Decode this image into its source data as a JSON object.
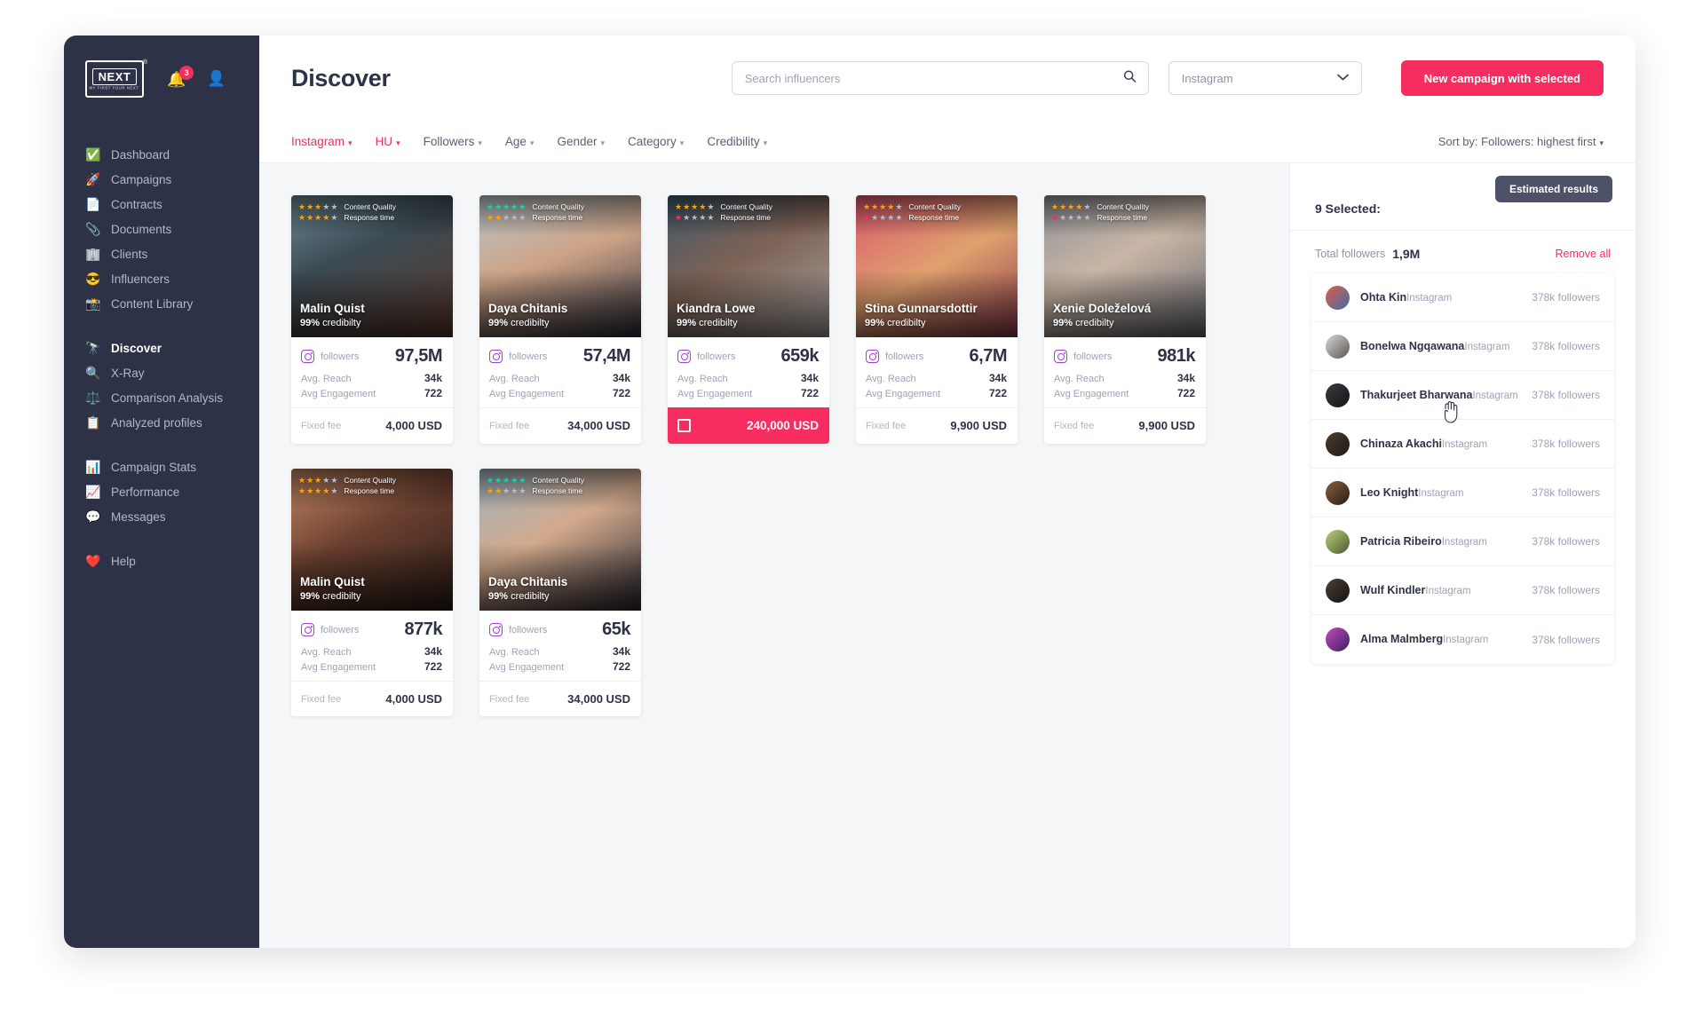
{
  "sidebar": {
    "logo": {
      "text": "NEXT",
      "tagline": "MY FIRST YOUR NEXT",
      "registered": "®"
    },
    "notifications": {
      "icon": "bell-icon",
      "count": "3"
    },
    "account_icon": "user-icon",
    "groups": [
      {
        "items": [
          {
            "icon": "✅",
            "icon_name": "check-mark-icon",
            "label": "Dashboard",
            "active": false
          },
          {
            "icon": "🚀",
            "icon_name": "rocket-icon",
            "label": "Campaigns",
            "active": false
          },
          {
            "icon": "📄",
            "icon_name": "document-icon",
            "label": "Contracts",
            "active": false
          },
          {
            "icon": "📎",
            "icon_name": "paperclip-icon",
            "label": "Documents",
            "active": false
          },
          {
            "icon": "🏢",
            "icon_name": "building-icon",
            "label": "Clients",
            "active": false
          },
          {
            "icon": "😎",
            "icon_name": "sunglasses-face-icon",
            "label": "Influencers",
            "active": false
          },
          {
            "icon": "📸",
            "icon_name": "camera-icon",
            "label": "Content Library",
            "active": false
          }
        ]
      },
      {
        "items": [
          {
            "icon": "🔭",
            "icon_name": "telescope-icon",
            "label": "Discover",
            "active": true
          },
          {
            "icon": "🔍",
            "icon_name": "magnifier-icon",
            "label": "X-Ray",
            "active": false
          },
          {
            "icon": "⚖️",
            "icon_name": "scales-icon",
            "label": "Comparison Analysis",
            "active": false
          },
          {
            "icon": "📋",
            "icon_name": "clipboard-icon",
            "label": "Analyzed profiles",
            "active": false
          }
        ]
      },
      {
        "items": [
          {
            "icon": "📊",
            "icon_name": "bar-chart-icon",
            "label": "Campaign Stats",
            "active": false
          },
          {
            "icon": "📈",
            "icon_name": "line-chart-icon",
            "label": "Performance",
            "active": false
          },
          {
            "icon": "💬",
            "icon_name": "speech-bubble-icon",
            "label": "Messages",
            "active": false
          }
        ]
      },
      {
        "items": [
          {
            "icon": "❤️",
            "icon_name": "heart-icon",
            "label": "Help",
            "active": false
          }
        ]
      }
    ]
  },
  "header": {
    "title": "Discover",
    "search": {
      "placeholder": "Search influencers",
      "value": "",
      "icon": "search-icon"
    },
    "platform_select": {
      "value": "Instagram",
      "icon": "chevron-down-icon"
    },
    "cta": "New campaign with selected"
  },
  "filters": {
    "items": [
      {
        "label": "Instagram",
        "highlight": true
      },
      {
        "label": "HU",
        "highlight": true
      },
      {
        "label": "Followers",
        "highlight": false
      },
      {
        "label": "Age",
        "highlight": false
      },
      {
        "label": "Gender",
        "highlight": false
      },
      {
        "label": "Category",
        "highlight": false
      },
      {
        "label": "Credibility",
        "highlight": false
      }
    ],
    "sort": "Sort by: Followers: highest first"
  },
  "labels": {
    "content_quality": "Content Quality",
    "response_time": "Response time",
    "followers": "followers",
    "avg_reach": "Avg. Reach",
    "avg_engagement": "Avg Engagement",
    "fixed_fee": "Fixed fee",
    "credibility_suffix": "credibilty"
  },
  "cards": [
    {
      "name": "Malin Quist",
      "credibility": "99%",
      "credibility_label": "credibilty",
      "followers": "97,5M",
      "avg_reach": "34k",
      "avg_engagement": "722",
      "fee": "4,000 USD",
      "selected": false,
      "quality_stars": 3,
      "quality_color": "#f5a21c",
      "response_stars": 4,
      "response_color": "#f5a21c",
      "photo": "linear-gradient(155deg,#6d8a94 0%,#3b4a52 40%,#5c3a2e 100%)"
    },
    {
      "name": "Daya Chitanis",
      "credibility": "99%",
      "credibility_label": "credibilty",
      "followers": "57,4M",
      "avg_reach": "34k",
      "avg_engagement": "722",
      "fee": "34,000 USD",
      "selected": false,
      "quality_stars": 5,
      "quality_color": "#1ccfae",
      "response_stars": 2,
      "response_color": "#f5a21c",
      "photo": "linear-gradient(160deg,#b9c7cc 0%,#cda387 45%,#2c2f3c 100%)"
    },
    {
      "name": "Kiandra Lowe",
      "credibility": "99%",
      "credibility_label": "credibilty",
      "followers": "659k",
      "avg_reach": "34k",
      "avg_engagement": "722",
      "fee": "240,000 USD",
      "selected": true,
      "quality_stars": 4,
      "quality_color": "#f5a21c",
      "response_stars": 1,
      "response_color": "#f72d5f",
      "photo": "linear-gradient(150deg,#41596b 0%,#7d6255 45%,#a9a5a2 100%)"
    },
    {
      "name": "Stina Gunnarsdottir",
      "credibility": "99%",
      "credibility_label": "credibilty",
      "followers": "6,7M",
      "avg_reach": "34k",
      "avg_engagement": "722",
      "fee": "9,900 USD",
      "selected": false,
      "quality_stars": 4,
      "quality_color": "#f5a21c",
      "response_stars": 1,
      "response_color": "#f72d5f",
      "photo": "linear-gradient(150deg,#d9566f 0%,#e0a16e 50%,#8f3b4c 100%)"
    },
    {
      "name": "Xenie Doleželová",
      "credibility": "99%",
      "credibility_label": "credibilty",
      "followers": "981k",
      "avg_reach": "34k",
      "avg_engagement": "722",
      "fee": "9,900 USD",
      "selected": false,
      "quality_stars": 4,
      "quality_color": "#f5a21c",
      "response_stars": 1,
      "response_color": "#f72d5f",
      "photo": "linear-gradient(150deg,#8f9197 0%,#c9b6a6 45%,#6a6b72 100%)"
    },
    {
      "name": "Malin Quist",
      "credibility": "99%",
      "credibility_label": "credibilty",
      "followers": "877k",
      "avg_reach": "34k",
      "avg_engagement": "722",
      "fee": "4,000 USD",
      "selected": false,
      "quality_stars": 3,
      "quality_color": "#f5a21c",
      "response_stars": 4,
      "response_color": "#f5a21c",
      "photo": "linear-gradient(150deg,#c08562 0%,#6b4030 45%,#2a1c16 100%)"
    },
    {
      "name": "Daya Chitanis",
      "credibility": "99%",
      "credibility_label": "credibilty",
      "followers": "65k",
      "avg_reach": "34k",
      "avg_engagement": "722",
      "fee": "34,000 USD",
      "selected": false,
      "quality_stars": 5,
      "quality_color": "#1ccfae",
      "response_stars": 2,
      "response_color": "#f5a21c",
      "photo": "linear-gradient(150deg,#9fb4bd 0%,#d2a98c 45%,#2d2a33 100%)"
    }
  ],
  "right_pane": {
    "estimated_results": "Estimated results",
    "selected_title": "9 Selected:",
    "total_followers_label": "Total followers",
    "total_followers_value": "1,9M",
    "remove_all": "Remove all",
    "remove_icon": "close-icon",
    "rows": [
      {
        "name": "Ohta Kin",
        "platform": "Instagram",
        "followers": "378k followers",
        "avatar": "linear-gradient(135deg,#e05b4a,#3d6fa8)"
      },
      {
        "name": "Bonelwa Ngqawana",
        "platform": "Instagram",
        "followers": "378k followers",
        "avatar": "linear-gradient(135deg,#d8d8dc,#5a5550)"
      },
      {
        "name": "Thakurjeet Bharwana",
        "platform": "Instagram",
        "followers": "378k followers",
        "avatar": "linear-gradient(135deg,#3a3a3c,#15161a)"
      },
      {
        "name": "Chinaza Akachi",
        "platform": "Instagram",
        "followers": "378k followers",
        "avatar": "linear-gradient(135deg,#4a3a2c,#1f1a16)"
      },
      {
        "name": "Leo Knight",
        "platform": "Instagram",
        "followers": "378k followers",
        "avatar": "linear-gradient(135deg,#8a5f3e,#2a1d14)"
      },
      {
        "name": "Patricia Ribeiro",
        "platform": "Instagram",
        "followers": "378k followers",
        "avatar": "linear-gradient(135deg,#bcd07a,#4d5a2e)"
      },
      {
        "name": "Wulf Kindler",
        "platform": "Instagram",
        "followers": "378k followers",
        "avatar": "linear-gradient(135deg,#4b4038,#15120f)"
      },
      {
        "name": "Alma Malmberg",
        "platform": "Instagram",
        "followers": "378k followers",
        "avatar": "linear-gradient(135deg,#c74bc0,#3a2060)"
      }
    ]
  },
  "colors": {
    "accent": "#f72d5f",
    "dark": "#2e3246",
    "muted": "#9ea3b4",
    "teal": "#1ccfae",
    "amber": "#f5a21c"
  }
}
